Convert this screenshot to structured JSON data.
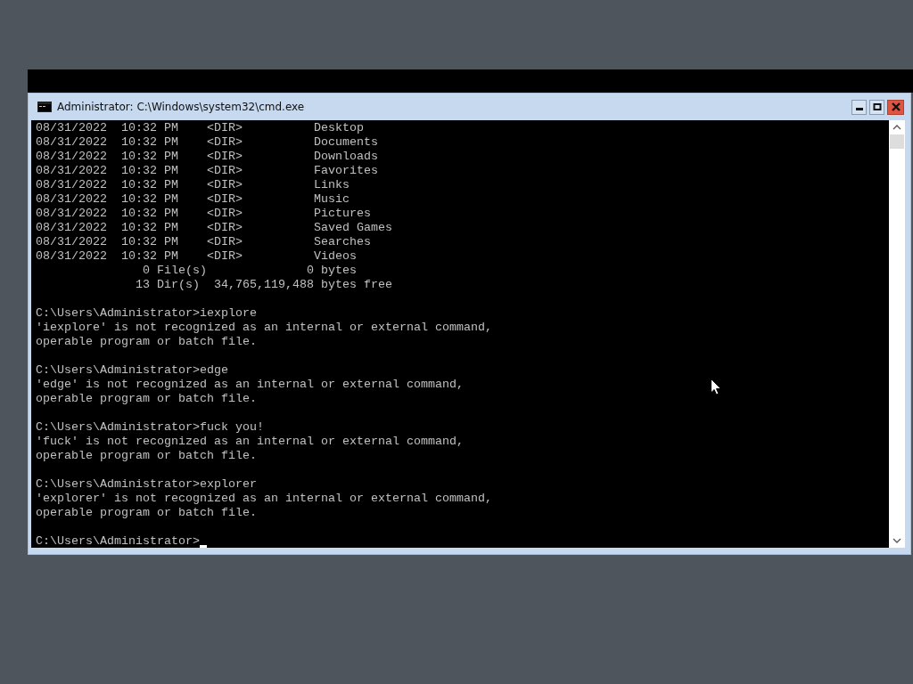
{
  "window": {
    "title": "Administrator: C:\\Windows\\system32\\cmd.exe"
  },
  "console": {
    "blocks": [
      {
        "lines": [
          "08/31/2022  10:32 PM    <DIR>          Desktop",
          "08/31/2022  10:32 PM    <DIR>          Documents",
          "08/31/2022  10:32 PM    <DIR>          Downloads",
          "08/31/2022  10:32 PM    <DIR>          Favorites",
          "08/31/2022  10:32 PM    <DIR>          Links",
          "08/31/2022  10:32 PM    <DIR>          Music",
          "08/31/2022  10:32 PM    <DIR>          Pictures",
          "08/31/2022  10:32 PM    <DIR>          Saved Games",
          "08/31/2022  10:32 PM    <DIR>          Searches",
          "08/31/2022  10:32 PM    <DIR>          Videos",
          "               0 File(s)              0 bytes",
          "              13 Dir(s)  34,765,119,488 bytes free"
        ]
      },
      {
        "lines": [
          "C:\\Users\\Administrator>iexplore",
          "'iexplore' is not recognized as an internal or external command,",
          "operable program or batch file."
        ]
      },
      {
        "lines": [
          "C:\\Users\\Administrator>edge",
          "'edge' is not recognized as an internal or external command,",
          "operable program or batch file."
        ]
      },
      {
        "lines": [
          "C:\\Users\\Administrator>fuck you!",
          "'fuck' is not recognized as an internal or external command,",
          "operable program or batch file."
        ]
      },
      {
        "lines": [
          "C:\\Users\\Administrator>explorer",
          "'explorer' is not recognized as an internal or external command,",
          "operable program or batch file."
        ]
      }
    ],
    "prompt": "C:\\Users\\Administrator>"
  }
}
